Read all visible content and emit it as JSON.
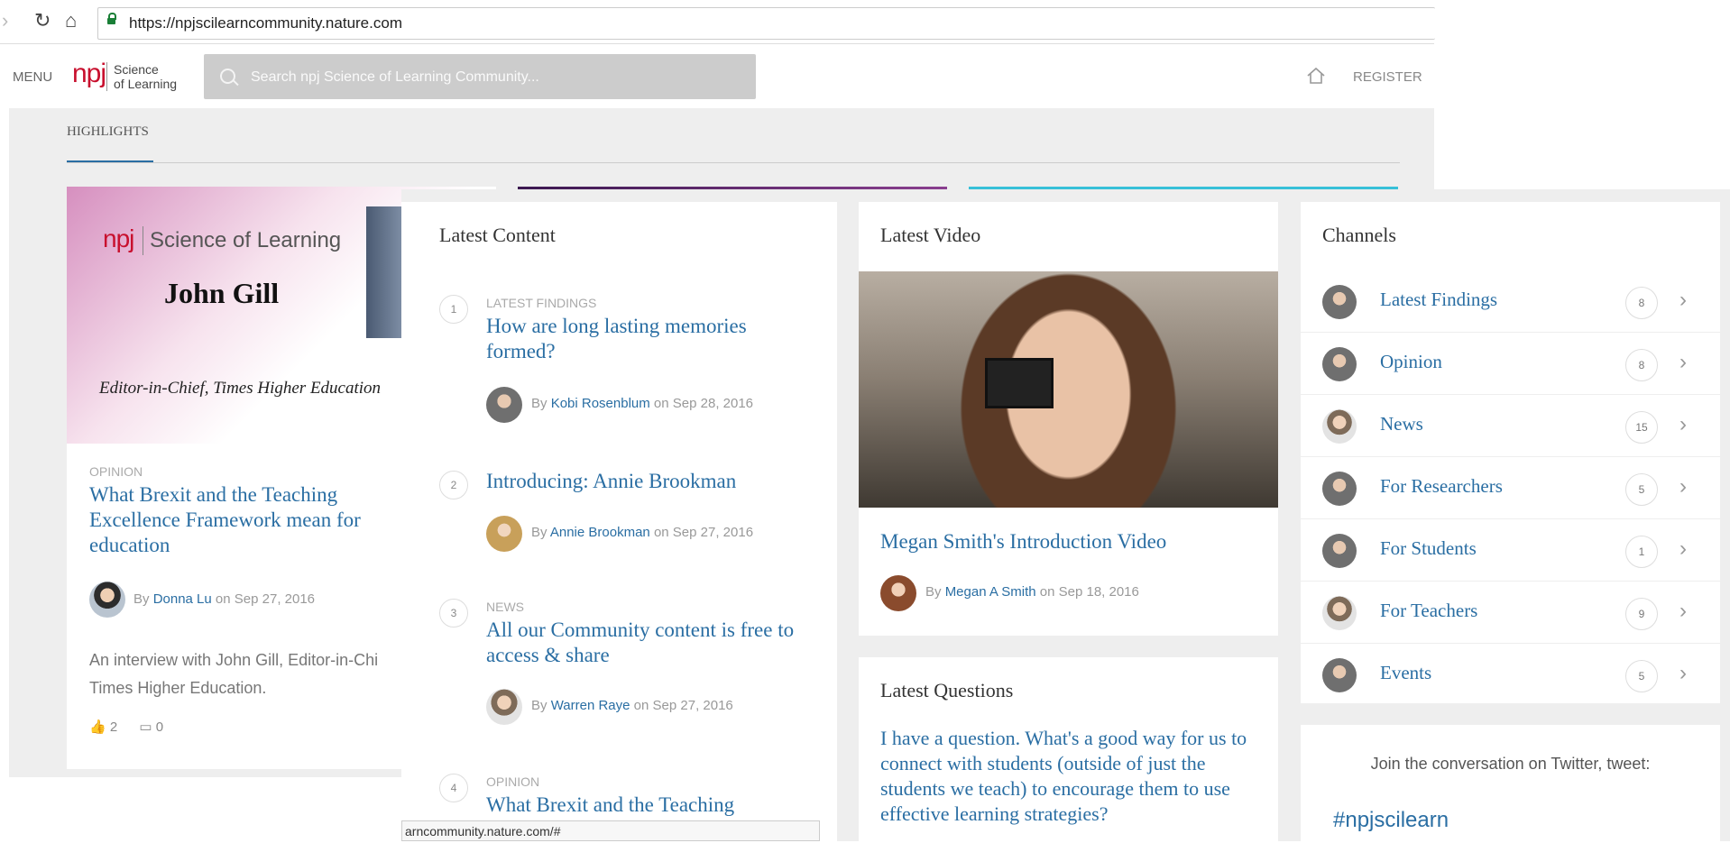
{
  "browser": {
    "url": "https://npjscilearncommunity.nature.com"
  },
  "header": {
    "menu_label": "MENU",
    "logo_mark": "npj",
    "logo_line1": "Science",
    "logo_line2": "of Learning",
    "search_placeholder": "Search npj Science of Learning Community...",
    "register_label": "REGISTER"
  },
  "subnav": {
    "label": "HIGHLIGHTS"
  },
  "highlight": {
    "banner_mark": "npj",
    "banner_title": "Science of Learning",
    "banner_name": "John Gill",
    "banner_role": "Editor-in-Chief, Times Higher Education",
    "category": "OPINION",
    "title": "What Brexit and the Teaching Excellence Framework mean for education",
    "by": "By",
    "author": "Donna Lu",
    "on": "on",
    "date": "Sep 27, 2016",
    "excerpt_line1": "An interview with John Gill, Editor-in-Chi",
    "excerpt_line2": "Times Higher Education.",
    "likes": "2",
    "comments": "0"
  },
  "latest_content": {
    "title": "Latest Content",
    "items": [
      {
        "num": "1",
        "category": "LATEST FINDINGS",
        "title": "How are long lasting memories formed?",
        "by": "By",
        "author": "Kobi Rosenblum",
        "on": "on",
        "date": "Sep 28, 2016"
      },
      {
        "num": "2",
        "category": "",
        "title": "Introducing: Annie Brookman",
        "by": "By",
        "author": "Annie Brookman",
        "on": "on",
        "date": "Sep 27, 2016"
      },
      {
        "num": "3",
        "category": "NEWS",
        "title": "All our Community content is free to access & share",
        "by": "By",
        "author": "Warren Raye",
        "on": "on",
        "date": "Sep 27, 2016"
      },
      {
        "num": "4",
        "category": "OPINION",
        "title": "What Brexit and the Teaching Excellence Framework mean for"
      }
    ]
  },
  "latest_video": {
    "title": "Latest Video",
    "video_title": "Megan Smith's Introduction Video",
    "by": "By",
    "author": "Megan A Smith",
    "on": "on",
    "date": "Sep 18, 2016"
  },
  "latest_questions": {
    "title": "Latest Questions",
    "question": "I have a question. What's a good way for us to connect with students (outside of just the students we teach) to encourage them to use effective learning strategies?"
  },
  "channels": {
    "title": "Channels",
    "items": [
      {
        "name": "Latest Findings",
        "count": "8"
      },
      {
        "name": "Opinion",
        "count": "8"
      },
      {
        "name": "News",
        "count": "15"
      },
      {
        "name": "For Researchers",
        "count": "5"
      },
      {
        "name": "For Students",
        "count": "1"
      },
      {
        "name": "For Teachers",
        "count": "9"
      },
      {
        "name": "Events",
        "count": "5"
      }
    ]
  },
  "twitter": {
    "prompt": "Join the conversation on Twitter, tweet:",
    "hashtag": "#npjscilearn"
  },
  "status_bar": {
    "text": "arncommunity.nature.com/#"
  },
  "colors": {
    "link": "#2a6ea3",
    "brand_red": "#c8102e"
  }
}
